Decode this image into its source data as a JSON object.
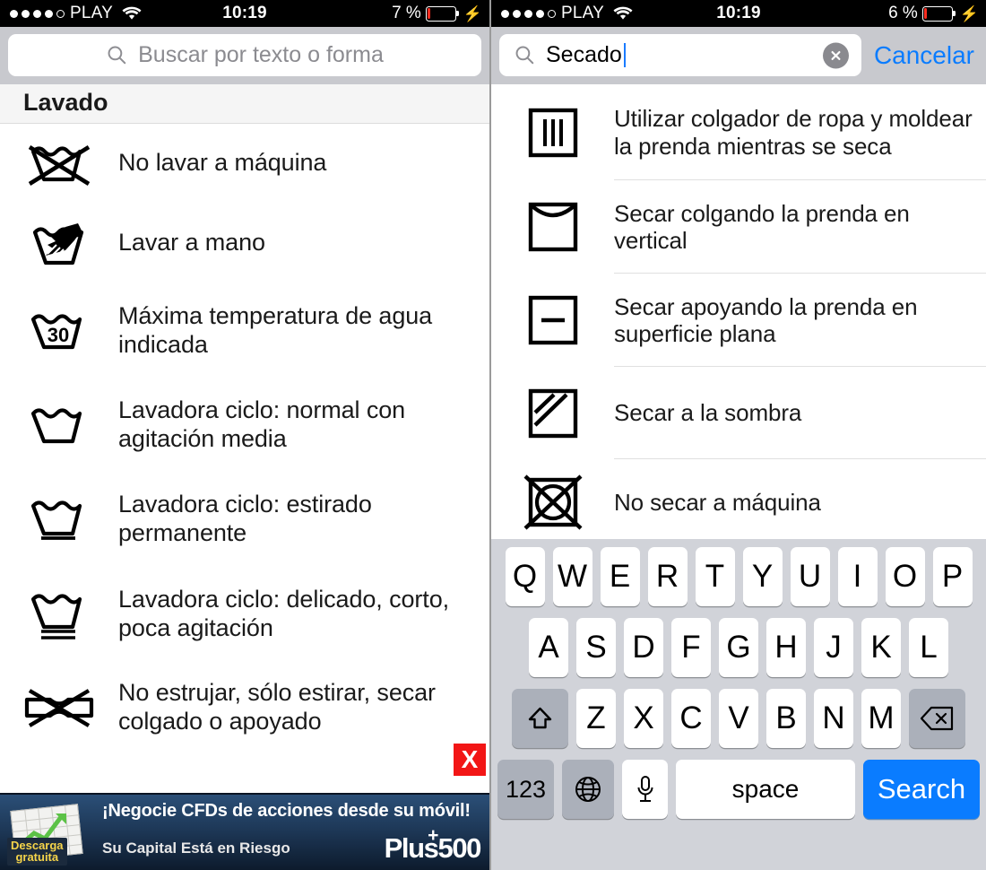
{
  "left": {
    "status_bar": {
      "signal_dots": 5,
      "signal_filled": 4,
      "carrier": "PLAY",
      "wifi_icon": "wifi-icon",
      "time": "10:19",
      "battery_text": "7 %",
      "battery_percent": 7,
      "charging_icon": "lightning-bolt-icon"
    },
    "search": {
      "icon": "search-icon",
      "placeholder": "Buscar por texto o forma",
      "value": ""
    },
    "section_header": "Lavado",
    "items": [
      {
        "icon": "no-machine-wash-icon",
        "label": "No lavar a máquina"
      },
      {
        "icon": "hand-wash-icon",
        "label": "Lavar a mano"
      },
      {
        "icon": "wash-temp-30-icon",
        "label": "Máxima temperatura de agua indicada"
      },
      {
        "icon": "wash-normal-icon",
        "label": "Lavadora ciclo: normal con agitación media"
      },
      {
        "icon": "wash-permanent-press-icon",
        "label": "Lavadora ciclo: estirado permanente"
      },
      {
        "icon": "wash-delicate-icon",
        "label": "Lavadora ciclo: delicado, corto, poca agitación"
      },
      {
        "icon": "do-not-wring-icon",
        "label": "No estrujar, sólo estirar, secar colgado o apoyado"
      }
    ],
    "ad": {
      "close_label": "X",
      "thumb_badge_line1": "Descarga",
      "thumb_badge_line2": "gratuita",
      "headline": "¡Negocie CFDs de acciones desde su móvil!",
      "subline": "Su Capital Está en Riesgo",
      "brand": "Plus500",
      "brand_left": "Plus",
      "brand_right": "500",
      "brand_plus": "+",
      "bg_color": "#1d3756",
      "close_color": "#f21616"
    }
  },
  "right": {
    "status_bar": {
      "signal_dots": 5,
      "signal_filled": 4,
      "carrier": "PLAY",
      "wifi_icon": "wifi-icon",
      "time": "10:19",
      "battery_text": "6 %",
      "battery_percent": 6,
      "charging_icon": "lightning-bolt-icon"
    },
    "search": {
      "icon": "search-icon",
      "value": "Secado",
      "placeholder": "Buscar por texto o forma",
      "clear_icon": "clear-circle-icon",
      "cancel_label": "Cancelar",
      "cancel_color": "#0a7cff"
    },
    "items": [
      {
        "icon": "drip-dry-on-hanger-icon",
        "label": "Utilizar colgador de ropa y moldear la prenda mientras se seca"
      },
      {
        "icon": "hang-to-dry-icon",
        "label": "Secar colgando la prenda en vertical"
      },
      {
        "icon": "dry-flat-icon",
        "label": "Secar apoyando la prenda en superficie plana"
      },
      {
        "icon": "dry-in-shade-icon",
        "label": "Secar a la sombra"
      },
      {
        "icon": "do-not-tumble-dry-icon",
        "label": "No secar a máquina"
      }
    ],
    "keyboard": {
      "row1": [
        "Q",
        "W",
        "E",
        "R",
        "T",
        "Y",
        "U",
        "I",
        "O",
        "P"
      ],
      "row2": [
        "A",
        "S",
        "D",
        "F",
        "G",
        "H",
        "J",
        "K",
        "L"
      ],
      "row3": [
        "Z",
        "X",
        "C",
        "V",
        "B",
        "N",
        "M"
      ],
      "shift_icon": "shift-arrow-icon",
      "backspace_icon": "backspace-icon",
      "numbers_label": "123",
      "globe_icon": "globe-icon",
      "mic_icon": "microphone-icon",
      "space_label": "space",
      "search_label": "Search",
      "search_key_color": "#0a7cff"
    }
  }
}
